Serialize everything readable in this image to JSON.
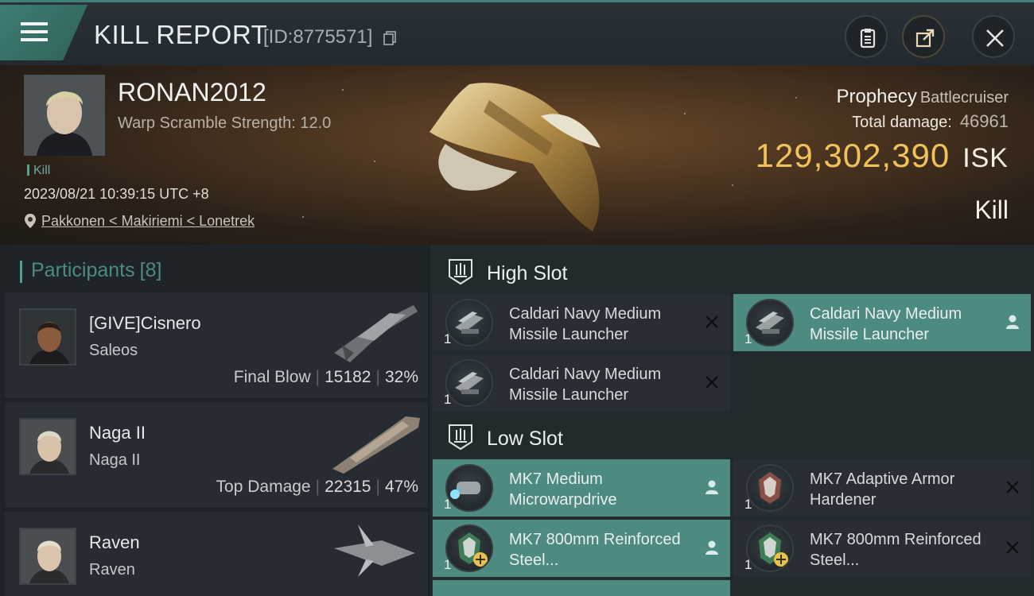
{
  "header": {
    "title": "KILL REPORT",
    "report_id": "[ID:8775571]"
  },
  "victim": {
    "name": "RONAN2012",
    "warp_scramble": "Warp Scramble Strength: 12.0",
    "kill_tag": "Kill",
    "timestamp": "2023/08/21 10:39:15 UTC +8",
    "location": "Pakkonen < Makiriemi < Lonetrek",
    "ship_name": "Prophecy",
    "ship_class": "Battlecruiser",
    "total_damage_label": "Total damage:",
    "total_damage_value": "46961",
    "isk_value": "129,302,390",
    "isk_unit": "ISK",
    "result_label": "Kill"
  },
  "participants": {
    "title": "Participants",
    "count": "[8]",
    "rows": [
      {
        "name": "[GIVE]Cisnero",
        "ship": "Saleos",
        "label": "Final Blow",
        "damage": "15182",
        "percent": "32%"
      },
      {
        "name": "Naga II",
        "ship": "Naga II",
        "label": "Top Damage",
        "damage": "22315",
        "percent": "47%"
      },
      {
        "name": "Raven",
        "ship": "Raven"
      }
    ]
  },
  "slots": {
    "high": {
      "label": "High Slot",
      "items": [
        {
          "qty": "1",
          "name": "Caldari Navy Medium Missile Launcher",
          "state": "destroyed"
        },
        {
          "qty": "1",
          "name": "Caldari Navy Medium Missile Launcher",
          "state": "dropped"
        },
        {
          "qty": "1",
          "name": "Caldari Navy Medium Missile Launcher",
          "state": "destroyed"
        }
      ]
    },
    "low": {
      "label": "Low Slot",
      "items": [
        {
          "qty": "1",
          "name": "MK7 Medium Microwarpdrive",
          "state": "dropped"
        },
        {
          "qty": "1",
          "name": "MK7 Adaptive Armor Hardener",
          "state": "destroyed"
        },
        {
          "qty": "1",
          "name": "MK7 800mm Reinforced Steel...",
          "state": "dropped"
        },
        {
          "qty": "1",
          "name": "MK7 800mm Reinforced Steel...",
          "state": "destroyed"
        }
      ]
    }
  },
  "colors": {
    "accent_teal": "#4d8a82",
    "isk_gold": "#f2c25a"
  }
}
